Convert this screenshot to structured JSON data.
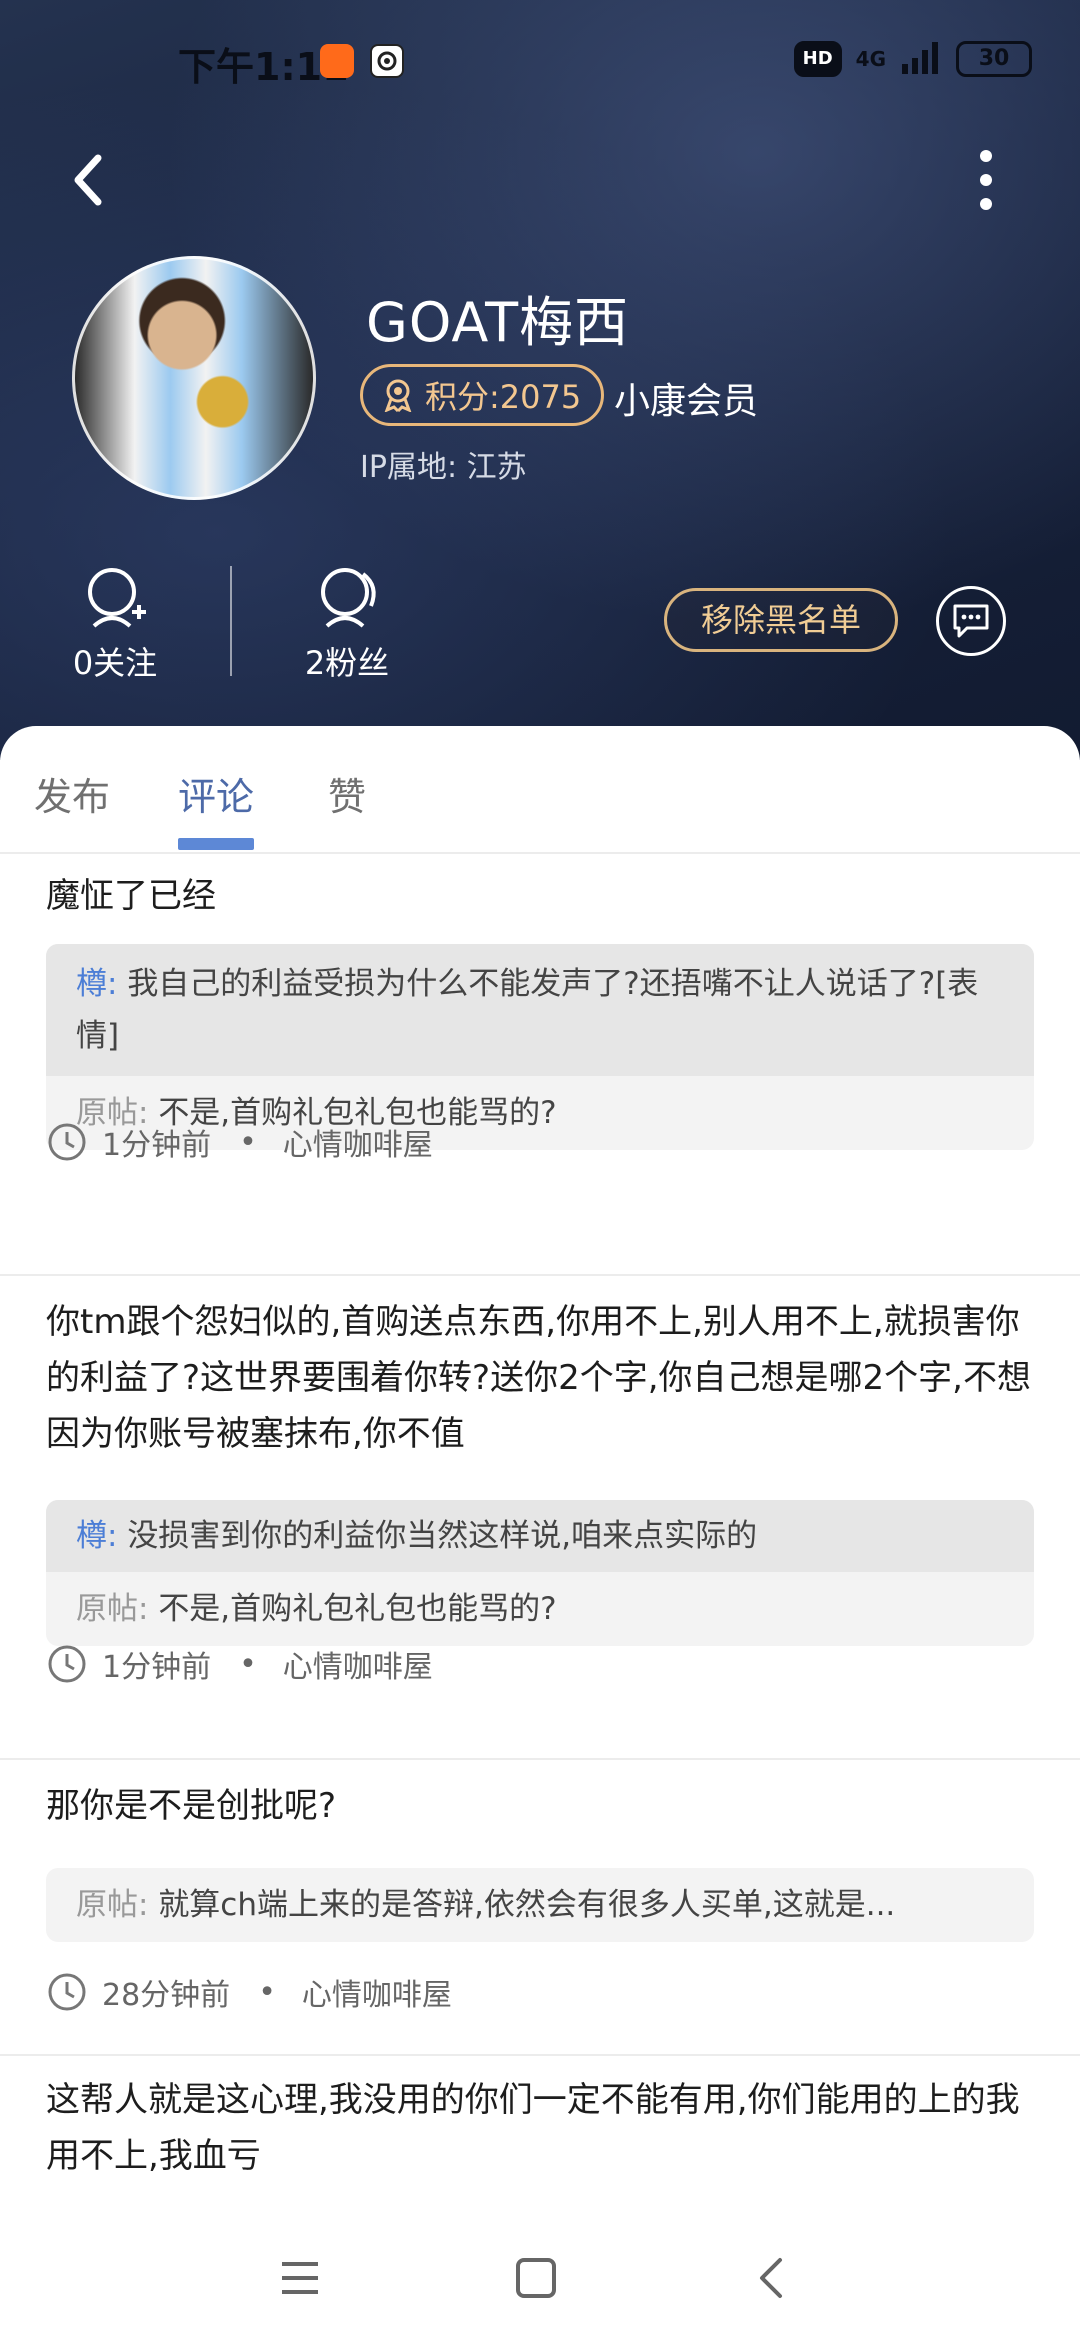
{
  "status_bar": {
    "time": "下午1:11",
    "hd": "HD",
    "network": "4G",
    "battery": "30"
  },
  "profile": {
    "name": "GOAT梅西",
    "score": "积分:2075",
    "member": "小康会员",
    "ip": "IP属地: 江苏",
    "follow_count": "0关注",
    "fans_count": "2粉丝",
    "unblock_label": "移除黑名单"
  },
  "tabs": [
    {
      "label": "发布",
      "active": false
    },
    {
      "label": "评论",
      "active": true
    },
    {
      "label": "赞",
      "active": false
    }
  ],
  "comments": [
    {
      "text": "魔怔了已经",
      "reply_who": "樽:",
      "reply_text": "我自己的利益受损为什么不能发声了?还捂嘴不让人说话了?[表情]",
      "orig_label": "原帖:",
      "orig_text": "不是,首购礼包礼包也能骂的?",
      "time": "1分钟前",
      "board": "心情咖啡屋"
    },
    {
      "text": "你tm跟个怨妇似的,首购送点东西,你用不上,别人用不上,就损害你的利益了?这世界要围着你转?送你2个字,你自己想是哪2个字,不想因为你账号被塞抹布,你不值",
      "reply_who": "樽:",
      "reply_text": "没损害到你的利益你当然这样说,咱来点实际的",
      "orig_label": "原帖:",
      "orig_text": "不是,首购礼包礼包也能骂的?",
      "time": "1分钟前",
      "board": "心情咖啡屋"
    },
    {
      "text": "那你是不是创批呢?",
      "orig_label": "原帖:",
      "orig_text": "就算ch端上来的是答辩,依然会有很多人买单,这就是...",
      "time": "28分钟前",
      "board": "心情咖啡屋"
    },
    {
      "text": "这帮人就是这心理,我没用的你们一定不能有用,你们能用的上的我用不上,我血亏"
    }
  ],
  "colors": {
    "accent": "#5d88d6",
    "gold": "#e8b77a",
    "reply_name": "#4c7ed6"
  }
}
